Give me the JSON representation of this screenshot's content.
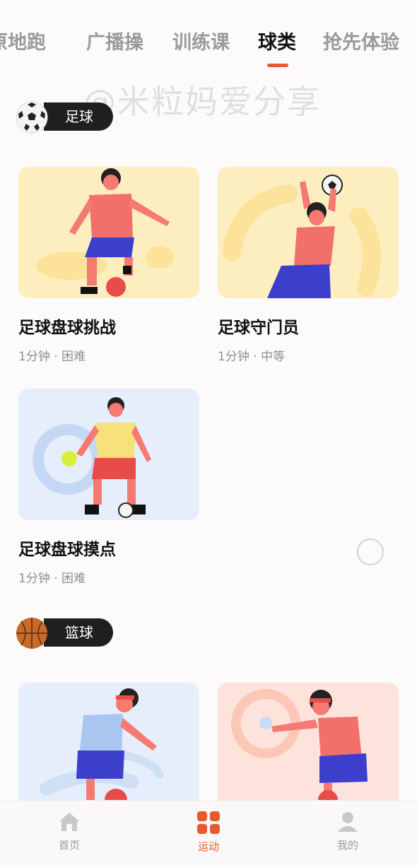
{
  "tabs": [
    {
      "label": "原地跑"
    },
    {
      "label": "广播操"
    },
    {
      "label": "训练课"
    },
    {
      "label": "球类"
    },
    {
      "label": "抢先体验"
    }
  ],
  "active_tab": "球类",
  "watermark": "@米粒妈爱分享",
  "sections": [
    {
      "title": "足球",
      "icon": "soccer-ball-icon",
      "cards": [
        {
          "title": "足球盘球挑战",
          "meta": "1分钟 · 困难",
          "image": "soccer-dribble-illustration"
        },
        {
          "title": "足球守门员",
          "meta": "1分钟 · 中等",
          "image": "soccer-goalkeeper-illustration"
        },
        {
          "title": "足球盘球摸点",
          "meta": "1分钟 · 困难",
          "image": "soccer-touch-illustration"
        }
      ]
    },
    {
      "title": "篮球",
      "icon": "basketball-icon",
      "cards": [
        {
          "title": "",
          "meta": "",
          "image": "basketball-dribble-illustration"
        },
        {
          "title": "",
          "meta": "",
          "image": "basketball-target-illustration"
        }
      ]
    }
  ],
  "bottom_nav": [
    {
      "label": "首页",
      "icon": "home-icon"
    },
    {
      "label": "运动",
      "icon": "sport-grid-icon"
    },
    {
      "label": "我的",
      "icon": "profile-icon"
    }
  ],
  "colors": {
    "accent": "#e8592f",
    "pill": "#1f1f22",
    "thumb_yellow": "#fdeec0",
    "thumb_blue": "#e6eefb",
    "thumb_pink": "#fde3dc"
  }
}
